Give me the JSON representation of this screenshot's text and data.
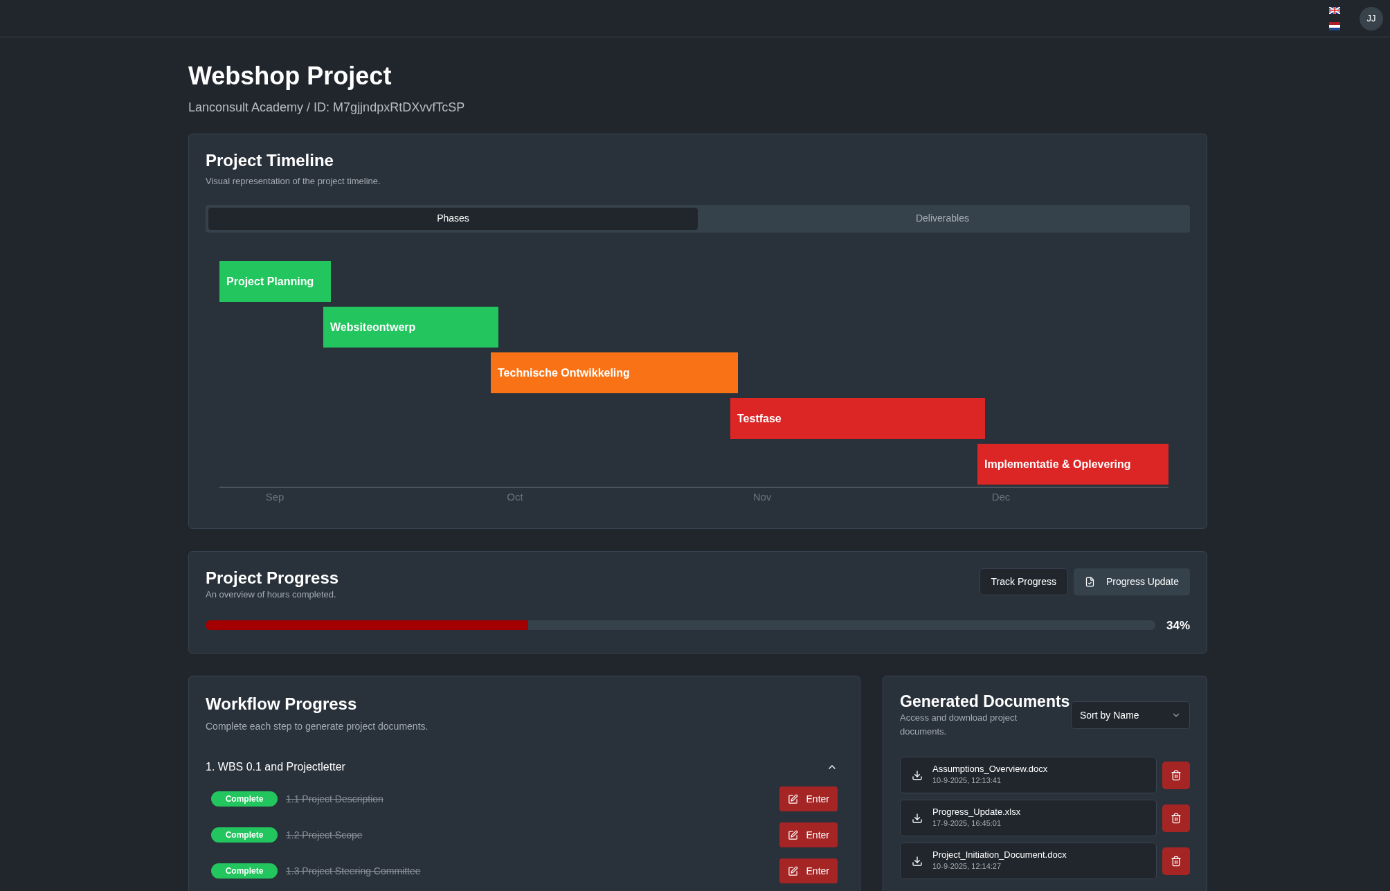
{
  "header": {
    "avatar": "JJ"
  },
  "project": {
    "title": "Webshop Project",
    "subtitle": "Lanconsult Academy / ID: M7gjjndpxRtDXvvfTcSP"
  },
  "timeline": {
    "title": "Project Timeline",
    "description": "Visual representation of the project timeline.",
    "tabs": [
      {
        "label": "Phases",
        "selected": true
      },
      {
        "label": "Deliverables",
        "selected": false
      }
    ],
    "phases": [
      {
        "label": "Project Planning",
        "color": "#22c55e"
      },
      {
        "label": "Websiteontwerp",
        "color": "#22c55e"
      },
      {
        "label": "Technische Ontwikkeling",
        "color": "#f97316"
      },
      {
        "label": "Testfase",
        "color": "#dc2626"
      },
      {
        "label": "Implementatie & Oplevering",
        "color": "#dc2626"
      }
    ],
    "axis_labels": [
      "Sep",
      "Oct",
      "Nov",
      "Dec"
    ]
  },
  "progress": {
    "title": "Project Progress",
    "description": "An overview of hours completed.",
    "buttons": [
      "Track Progress",
      "Progress Update"
    ],
    "level": 0.34,
    "reading": "34%"
  },
  "workflow": {
    "title": "Workflow Progress",
    "description": "Complete each step to generate project documents.",
    "section": {
      "title": "1. WBS 0.1 and Projectletter",
      "expanded": true,
      "steps": [
        {
          "status": "Complete",
          "label": "1.1 Project Description",
          "done": true,
          "button": "Enter"
        },
        {
          "status": "Complete",
          "label": "1.2 Project Scope",
          "done": true,
          "button": "Enter"
        },
        {
          "status": "Complete",
          "label": "1.3 Project Steering Committee",
          "done": true,
          "button": "Enter"
        }
      ]
    }
  },
  "documents": {
    "title": "Generated Documents",
    "description": "Access and download project documents.",
    "sort": "Sort by Name",
    "files": [
      {
        "name": "Assumptions_Overview.docx",
        "date": "10-9-2025, 12:13:41"
      },
      {
        "name": "Progress_Update.xlsx",
        "date": "17-9-2025, 16:45:01"
      },
      {
        "name": "Project_Initiation_Document.docx",
        "date": "10-9-2025, 12:14:27"
      }
    ]
  }
}
